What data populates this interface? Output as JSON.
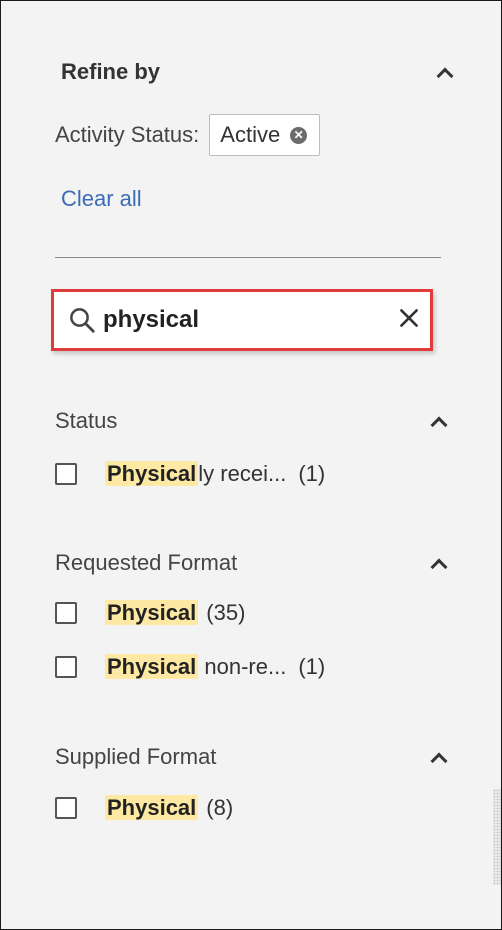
{
  "refine": {
    "title": "Refine by",
    "active_filter_label": "Activity Status:",
    "active_filter_value": "Active",
    "clear_all": "Clear all"
  },
  "search": {
    "value": "physical",
    "placeholder": ""
  },
  "highlight_color": "#fde9a4",
  "search_border_color": "#e23b3b",
  "facets": [
    {
      "title": "Status",
      "items": [
        {
          "match": "Physical",
          "rest": "ly recei...",
          "count": "(1)"
        }
      ]
    },
    {
      "title": "Requested Format",
      "items": [
        {
          "match": "Physical",
          "rest": "",
          "count": "(35)"
        },
        {
          "match": "Physical",
          "rest": " non-re...",
          "count": "(1)"
        }
      ]
    },
    {
      "title": "Supplied Format",
      "items": [
        {
          "match": "Physical",
          "rest": "",
          "count": "(8)"
        }
      ]
    }
  ]
}
